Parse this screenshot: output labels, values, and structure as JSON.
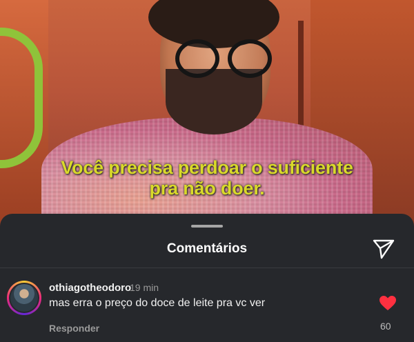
{
  "video": {
    "caption_line1": "Você precisa perdoar o suficiente",
    "caption_line2": "pra não doer."
  },
  "sheet": {
    "title": "Comentários"
  },
  "comment": {
    "username": "othiagotheodoro",
    "time": "19 min",
    "text": "mas erra o preço do doce de leite pra vc ver",
    "reply_label": "Responder",
    "likes": "60",
    "liked": true
  },
  "icons": {
    "share": "send-icon",
    "like": "heart-icon"
  },
  "colors": {
    "sheet_bg": "#26282c",
    "caption": "#d9d92a",
    "heart": "#ff3040"
  }
}
